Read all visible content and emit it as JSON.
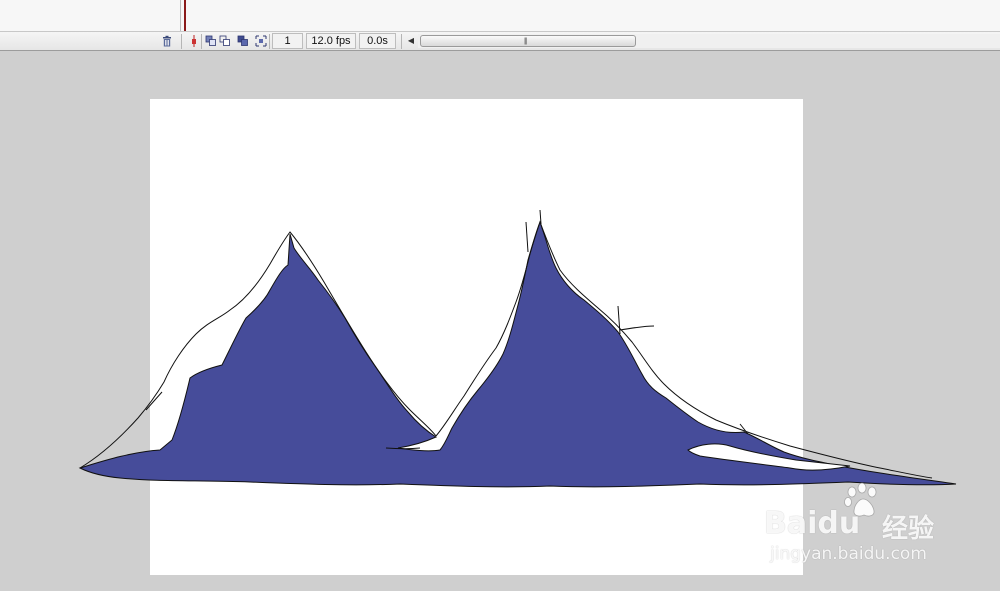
{
  "timeline": {
    "frame": "1",
    "fps": "12.0 fps",
    "elapsed": "0.0s"
  },
  "icons": {
    "delete_layer": "trash-icon",
    "center_frame": "center-frame-icon",
    "onion_skin": "onion-skin-icon",
    "onion_skin_outlines": "onion-skin-outlines-icon",
    "edit_multiple_frames": "edit-multiple-frames-icon",
    "modify_onion_markers": "modify-onion-markers-icon",
    "scroll_left": "scroll-left-icon"
  },
  "canvas": {
    "fill_color": "#464c9a",
    "stroke_color": "#111111",
    "stage_color": "#ffffff",
    "pasteboard_color": "#cfcfcf"
  },
  "watermark": {
    "brand": "Baidu",
    "brand_cn": "经验",
    "url": "jingyan.baidu.com"
  }
}
